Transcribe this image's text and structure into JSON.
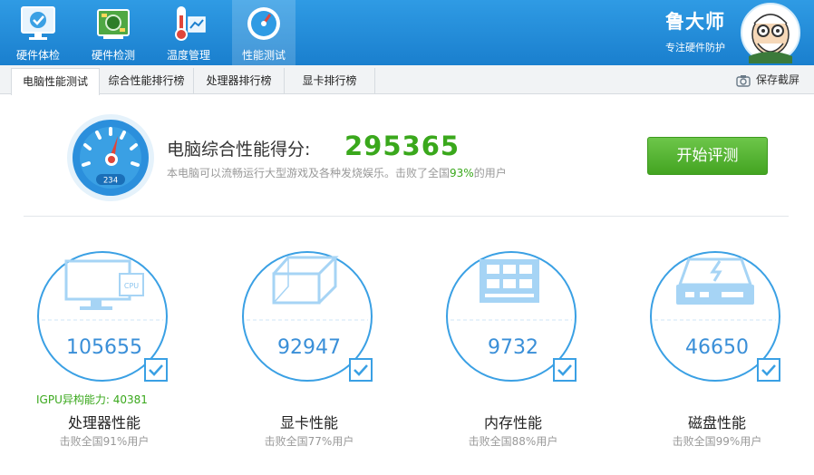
{
  "nav": {
    "items": [
      {
        "label": "硬件体检",
        "icon": "monitor-check-icon"
      },
      {
        "label": "硬件检测",
        "icon": "board-icon"
      },
      {
        "label": "温度管理",
        "icon": "thermometer-icon"
      },
      {
        "label": "性能测试",
        "icon": "speedometer-icon",
        "active": true
      }
    ],
    "brand_name": "鲁大师",
    "brand_slogan": "专注硬件防护"
  },
  "tabs": [
    {
      "label": "电脑性能测试",
      "active": true
    },
    {
      "label": "综合性能排行榜"
    },
    {
      "label": "处理器排行榜"
    },
    {
      "label": "显卡排行榜"
    }
  ],
  "snapshot_label": "保存截屏",
  "score": {
    "title": "电脑综合性能得分:",
    "value": "295365",
    "desc_prefix": "本电脑可以流畅运行大型游戏及各种发烧娱乐。击败了全国",
    "desc_percent": "93%",
    "desc_suffix": "的用户",
    "gauge_digits": "234"
  },
  "start_button": "开始评测",
  "cards": [
    {
      "name": "处理器性能",
      "value": "105655",
      "sub": "击败全国91%用户",
      "icon": "cpu-monitor-icon"
    },
    {
      "name": "显卡性能",
      "value": "92947",
      "sub": "击败全国77%用户",
      "icon": "3d-cube-icon"
    },
    {
      "name": "内存性能",
      "value": "9732",
      "sub": "击败全国88%用户",
      "icon": "memory-chip-icon"
    },
    {
      "name": "磁盘性能",
      "value": "46650",
      "sub": "击败全国99%用户",
      "icon": "disk-drive-icon"
    }
  ],
  "igpu": "IGPU异构能力: 40381",
  "colors": {
    "accent_blue": "#1a7fce",
    "score_green": "#3aa81c",
    "circle_blue": "#3aa0e4"
  }
}
